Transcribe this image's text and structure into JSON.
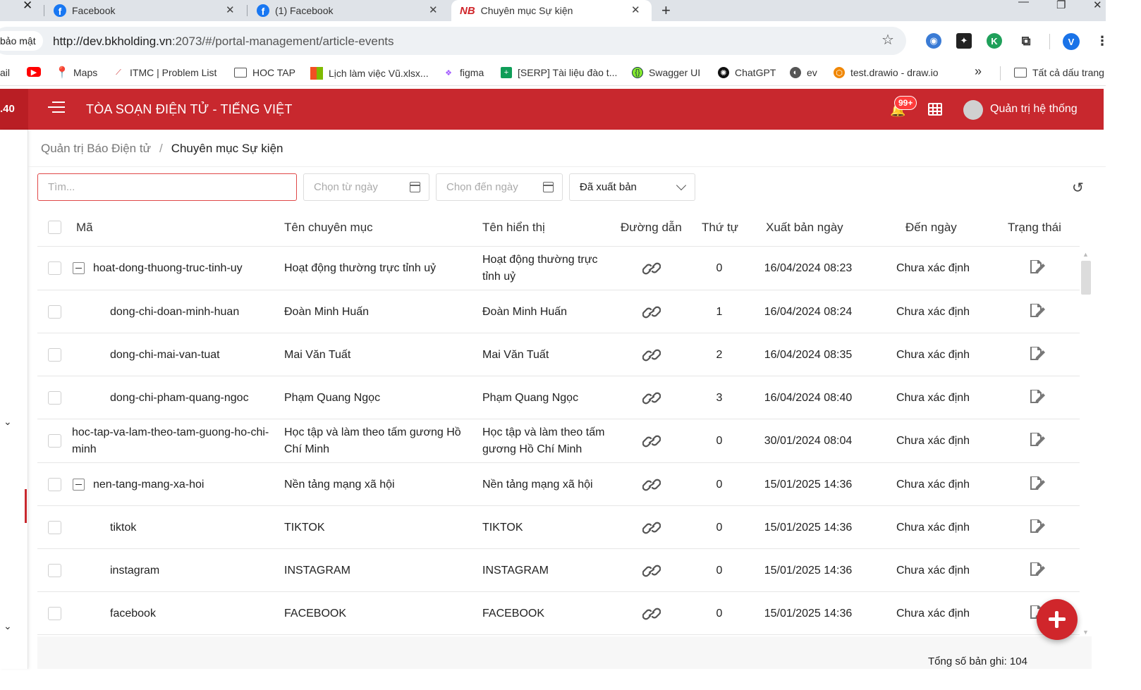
{
  "browser": {
    "tabs": [
      {
        "title": "Facebook",
        "icon": "facebook-icon"
      },
      {
        "title": "(1) Facebook",
        "icon": "facebook-icon"
      },
      {
        "title": "Chuyên mục Sự kiện",
        "icon": "nb-logo-icon",
        "active": true
      }
    ],
    "security_label": "bảo mật",
    "url_host": "http://dev.bkholding.vn",
    "url_rest": ":2073/#/portal-management/article-events",
    "ext_profile_letter": "V",
    "bookmarks": [
      {
        "label": "ail",
        "icon": "gmail-icon"
      },
      {
        "label": "",
        "icon": "youtube-icon"
      },
      {
        "label": "Maps",
        "icon": "maps-icon"
      },
      {
        "label": "ITMC | Problem List",
        "icon": "itmc-icon"
      },
      {
        "label": "HOC TAP",
        "icon": "folder-icon"
      },
      {
        "label": "Lịch làm việc Vũ.xlsx...",
        "icon": "windows-icon"
      },
      {
        "label": "figma",
        "icon": "figma-icon"
      },
      {
        "label": "[SERP] Tài liệu đào t...",
        "icon": "sheets-icon"
      },
      {
        "label": "Swagger UI",
        "icon": "swagger-icon"
      },
      {
        "label": "ChatGPT",
        "icon": "chatgpt-icon"
      },
      {
        "label": "ev",
        "icon": "globe-icon"
      },
      {
        "label": "test.drawio - draw.io",
        "icon": "drawio-icon"
      },
      {
        "label": "»",
        "icon": ""
      },
      {
        "label": "Tất cả dấu trang",
        "icon": "folder-icon"
      }
    ]
  },
  "header": {
    "version": ".40",
    "title": "TÒA SOẠN ĐIỆN TỬ - TIẾNG VIỆT",
    "notification_count": "99+",
    "user_name": "Quản trị hệ thống"
  },
  "breadcrumb": {
    "parent": "Quản trị Báo Điện tử",
    "separator": "/",
    "current": "Chuyên mục Sự kiện"
  },
  "filters": {
    "search_placeholder": "Tìm...",
    "from_date_placeholder": "Chọn từ ngày",
    "to_date_placeholder": "Chọn đến ngày",
    "status_value": "Đã xuất bản"
  },
  "table": {
    "columns": [
      "Mã",
      "Tên chuyên mục",
      "Tên hiển thị",
      "Đường dẫn",
      "Thứ tự",
      "Xuất bản ngày",
      "Đến ngày",
      "Trạng thái"
    ],
    "rows": [
      {
        "code": "hoat-dong-thuong-truc-tinh-uy",
        "name": "Hoạt động thường trực tỉnh uỷ",
        "display": "Hoạt động thường trực tỉnh uỷ",
        "order": "0",
        "publish": "16/04/2024 08:23",
        "until": "Chưa xác định"
      },
      {
        "code": "dong-chi-doan-minh-huan",
        "name": "Đoàn Minh Huấn",
        "display": "Đoàn Minh Huấn",
        "order": "1",
        "publish": "16/04/2024 08:24",
        "until": "Chưa xác định"
      },
      {
        "code": "dong-chi-mai-van-tuat",
        "name": "Mai Văn Tuất",
        "display": "Mai Văn Tuất",
        "order": "2",
        "publish": "16/04/2024 08:35",
        "until": "Chưa xác định"
      },
      {
        "code": "dong-chi-pham-quang-ngoc",
        "name": "Phạm Quang Ngọc",
        "display": "Phạm Quang Ngọc",
        "order": "3",
        "publish": "16/04/2024 08:40",
        "until": "Chưa xác định"
      },
      {
        "code": "hoc-tap-va-lam-theo-tam-guong-ho-chi-minh",
        "name": "Học tập và làm theo tấm gương Hồ Chí Minh",
        "display": "Học tập và làm theo tấm gương Hồ Chí Minh",
        "order": "0",
        "publish": "30/01/2024 08:04",
        "until": "Chưa xác định"
      },
      {
        "code": "nen-tang-mang-xa-hoi",
        "name": "Nền tảng mạng xã hội",
        "display": "Nền tảng mạng xã hội",
        "order": "0",
        "publish": "15/01/2025 14:36",
        "until": "Chưa xác định"
      },
      {
        "code": "tiktok",
        "name": "TIKTOK",
        "display": "TIKTOK",
        "order": "0",
        "publish": "15/01/2025 14:36",
        "until": "Chưa xác định"
      },
      {
        "code": "instagram",
        "name": "INSTAGRAM",
        "display": "INSTAGRAM",
        "order": "0",
        "publish": "15/01/2025 14:36",
        "until": "Chưa xác định"
      },
      {
        "code": "facebook",
        "name": "FACEBOOK",
        "display": "FACEBOOK",
        "order": "0",
        "publish": "15/01/2025 14:36",
        "until": "Chưa xác định"
      }
    ]
  },
  "footer": {
    "total_label": "Tổng số bản ghi: 104"
  },
  "colors": {
    "brand_red": "#c8282e",
    "fab_red": "#d0262b"
  }
}
